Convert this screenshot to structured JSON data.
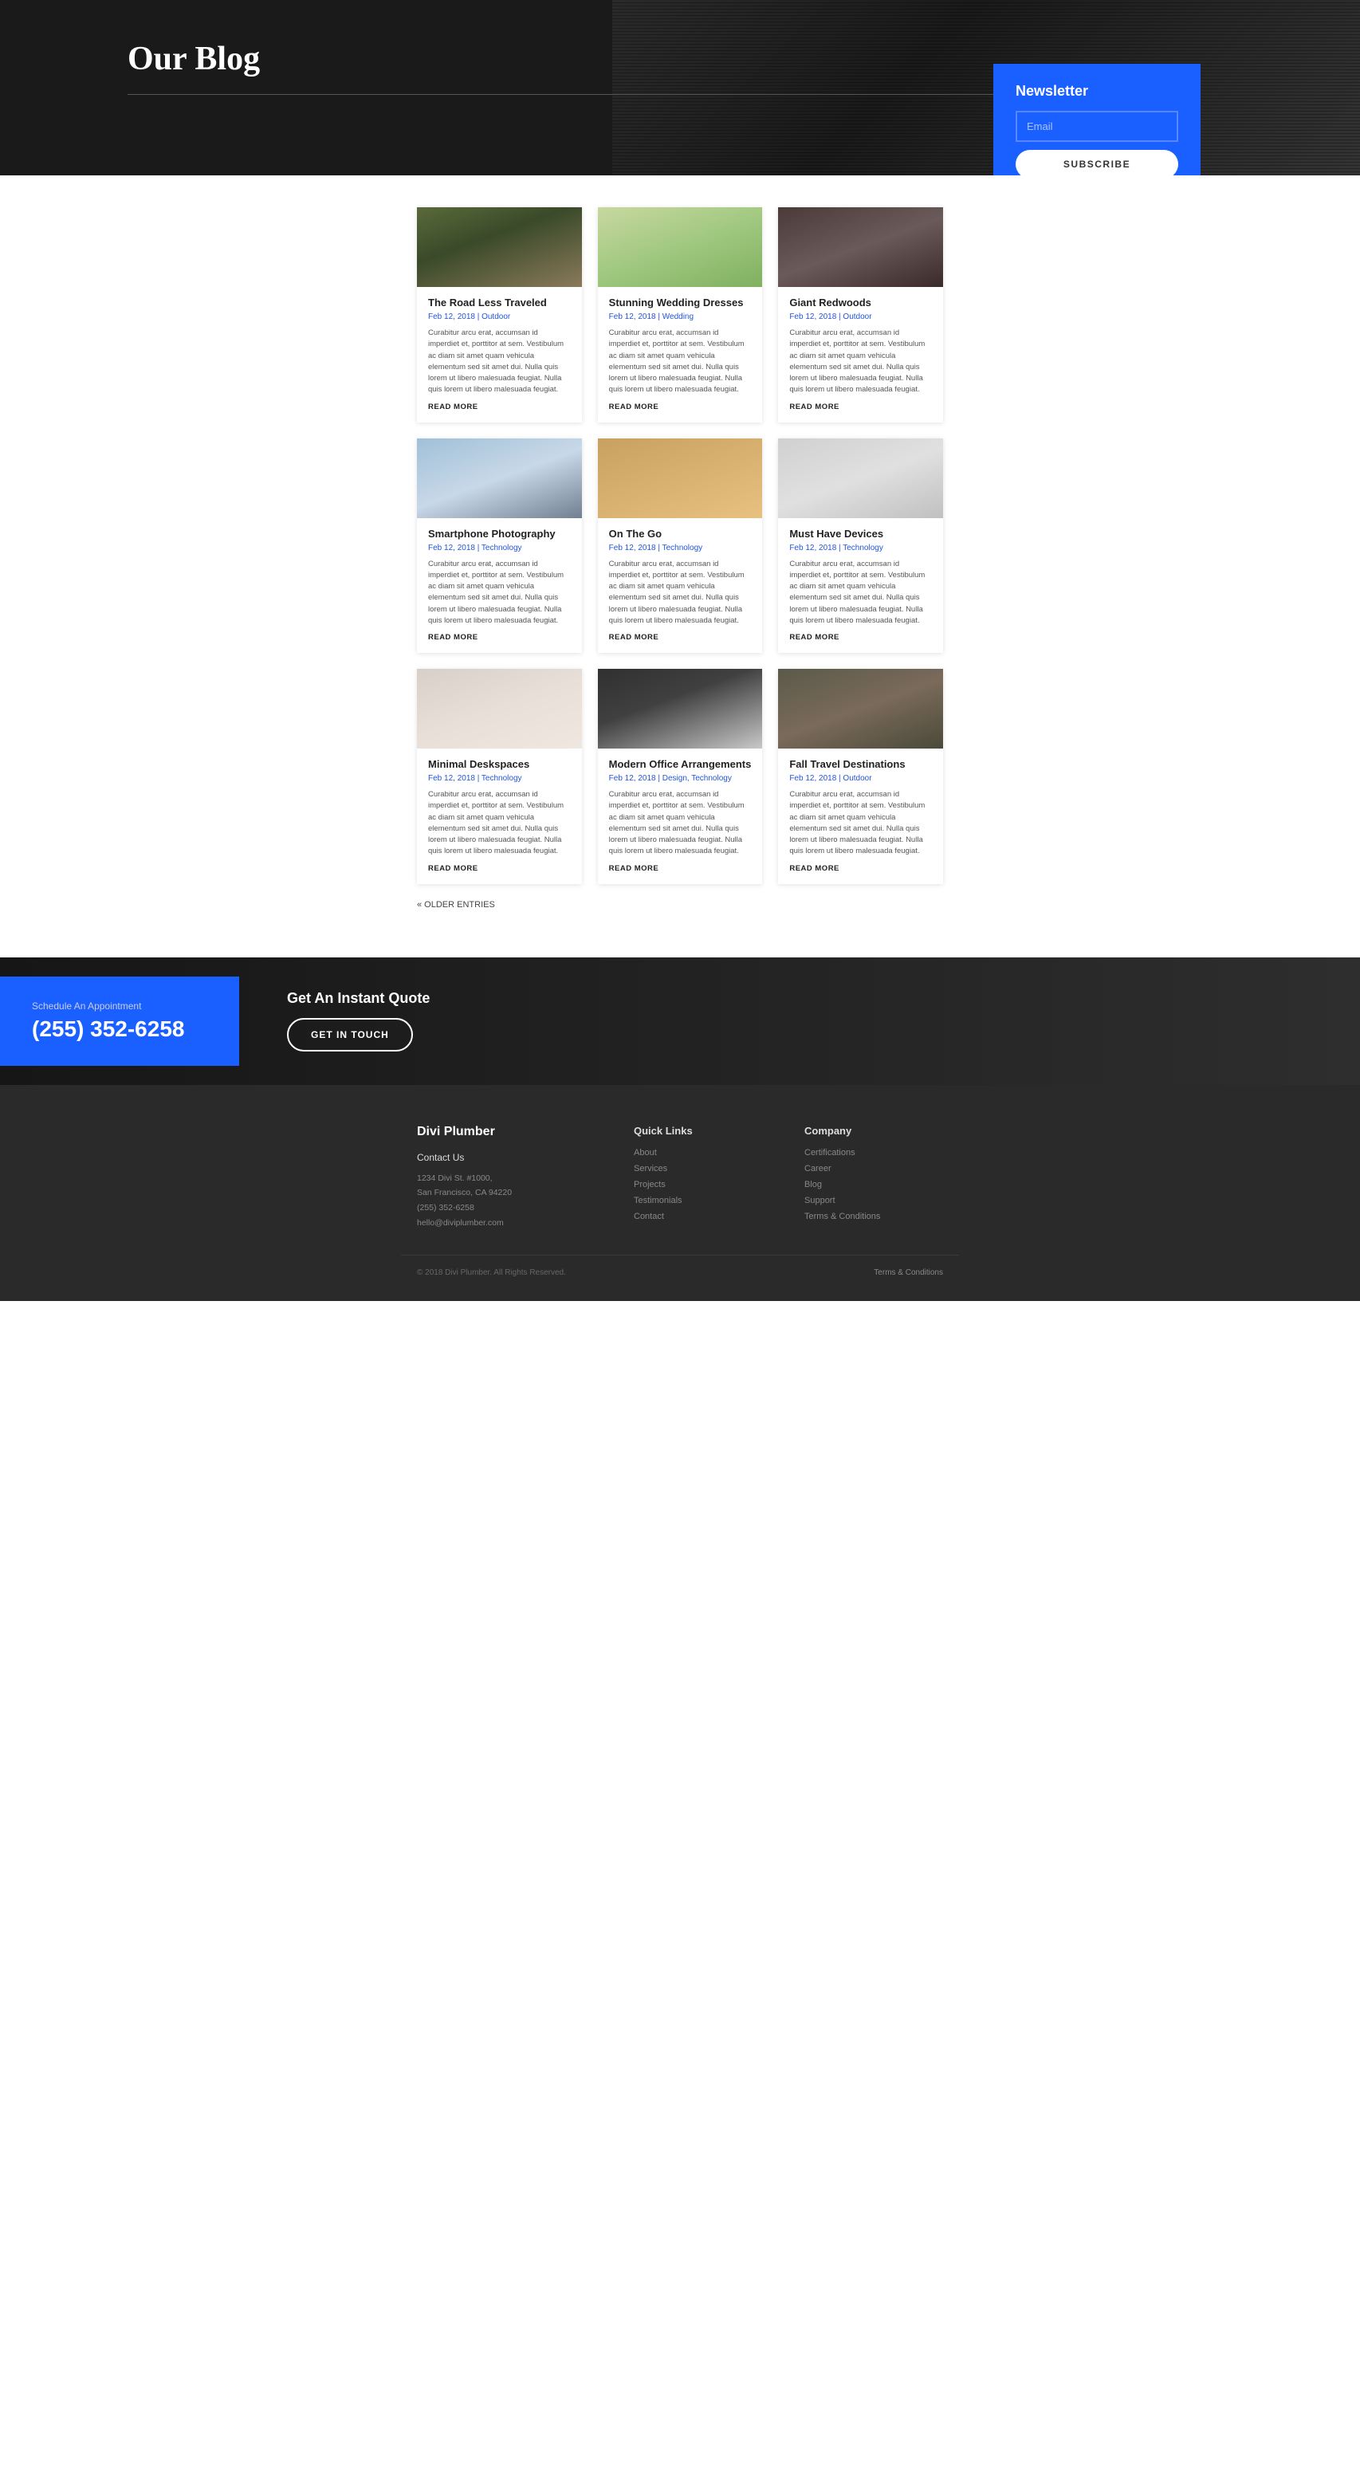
{
  "hero": {
    "title": "Our Blog"
  },
  "newsletter": {
    "heading": "Newsletter",
    "email_placeholder": "Email",
    "subscribe_label": "SUBSCRIBE"
  },
  "blog_rows": [
    {
      "cards": [
        {
          "img_class": "img-road",
          "title": "The Road Less Traveled",
          "meta": "Feb 12, 2018 | Outdoor",
          "excerpt": "Curabitur arcu erat, accumsan id imperdiet et, porttitor at sem. Vestibulum ac diam sit amet quam vehicula elementum sed sit amet dui. Nulla quis lorem ut libero malesuada feugiat. Nulla quis lorem ut libero malesuada feugiat.",
          "read_more": "READ MORE"
        },
        {
          "img_class": "img-wedding",
          "title": "Stunning Wedding Dresses",
          "meta": "Feb 12, 2018 | Wedding",
          "excerpt": "Curabitur arcu erat, accumsan id imperdiet et, porttitor at sem. Vestibulum ac diam sit amet quam vehicula elementum sed sit amet dui. Nulla quis lorem ut libero malesuada feugiat. Nulla quis lorem ut libero malesuada feugiat.",
          "read_more": "READ MORE"
        },
        {
          "img_class": "img-redwoods",
          "title": "Giant Redwoods",
          "meta": "Feb 12, 2018 | Outdoor",
          "excerpt": "Curabitur arcu erat, accumsan id imperdiet et, porttitor at sem. Vestibulum ac diam sit amet quam vehicula elementum sed sit amet dui. Nulla quis lorem ut libero malesuada feugiat. Nulla quis lorem ut libero malesuada feugiat.",
          "read_more": "READ MORE"
        }
      ]
    },
    {
      "cards": [
        {
          "img_class": "img-smartphone",
          "title": "Smartphone Photography",
          "meta": "Feb 12, 2018 | Technology",
          "excerpt": "Curabitur arcu erat, accumsan id imperdiet et, porttitor at sem. Vestibulum ac diam sit amet quam vehicula elementum sed sit amet dui. Nulla quis lorem ut libero malesuada feugiat. Nulla quis lorem ut libero malesuada feugiat.",
          "read_more": "READ MORE"
        },
        {
          "img_class": "img-onthego",
          "title": "On The Go",
          "meta": "Feb 12, 2018 | Technology",
          "excerpt": "Curabitur arcu erat, accumsan id imperdiet et, porttitor at sem. Vestibulum ac diam sit amet quam vehicula elementum sed sit amet dui. Nulla quis lorem ut libero malesuada feugiat. Nulla quis lorem ut libero malesuada feugiat.",
          "read_more": "READ MORE"
        },
        {
          "img_class": "img-mustdevices",
          "title": "Must Have Devices",
          "meta": "Feb 12, 2018 | Technology",
          "excerpt": "Curabitur arcu erat, accumsan id imperdiet et, porttitor at sem. Vestibulum ac diam sit amet quam vehicula elementum sed sit amet dui. Nulla quis lorem ut libero malesuada feugiat. Nulla quis lorem ut libero malesuada feugiat.",
          "read_more": "READ MORE"
        }
      ]
    },
    {
      "cards": [
        {
          "img_class": "img-minimal",
          "title": "Minimal Deskspaces",
          "meta": "Feb 12, 2018 | Technology",
          "excerpt": "Curabitur arcu erat, accumsan id imperdiet et, porttitor at sem. Vestibulum ac diam sit amet quam vehicula elementum sed sit amet dui. Nulla quis lorem ut libero malesuada feugiat. Nulla quis lorem ut libero malesuada feugiat.",
          "read_more": "READ MORE"
        },
        {
          "img_class": "img-officearrange",
          "title": "Modern Office Arrangements",
          "meta": "Feb 12, 2018 | Design, Technology",
          "excerpt": "Curabitur arcu erat, accumsan id imperdiet et, porttitor at sem. Vestibulum ac diam sit amet quam vehicula elementum sed sit amet dui. Nulla quis lorem ut libero malesuada feugiat. Nulla quis lorem ut libero malesuada feugiat.",
          "read_more": "READ MORE"
        },
        {
          "img_class": "img-fall",
          "title": "Fall Travel Destinations",
          "meta": "Feb 12, 2018 | Outdoor",
          "excerpt": "Curabitur arcu erat, accumsan id imperdiet et, porttitor at sem. Vestibulum ac diam sit amet quam vehicula elementum sed sit amet dui. Nulla quis lorem ut libero malesuada feugiat. Nulla quis lorem ut libero malesuada feugiat.",
          "read_more": "READ MORE"
        }
      ]
    }
  ],
  "older_entries": "« OLDER ENTRIES",
  "cta": {
    "schedule_label": "Schedule An Appointment",
    "phone": "(255) 352-6258",
    "quote_label": "Get An Instant Quote",
    "get_in_touch": "GET IN TOUCH"
  },
  "footer": {
    "brand": "Divi Plumber",
    "contact_label": "Contact Us",
    "address_line1": "1234 Divi St. #1000,",
    "address_line2": "San Francisco, CA 94220",
    "phone": "(255) 352-6258",
    "email": "hello@diviplumber.com",
    "quick_links_label": "Quick Links",
    "quick_links": [
      "About",
      "Services",
      "Projects",
      "Testimonials",
      "Contact"
    ],
    "company_label": "Company",
    "company_links": [
      "Certifications",
      "Career",
      "Blog",
      "Support",
      "Terms & Conditions"
    ],
    "copyright": "© 2018 Divi Plumber. All Rights Reserved.",
    "terms_label": "Terms & Conditions"
  }
}
